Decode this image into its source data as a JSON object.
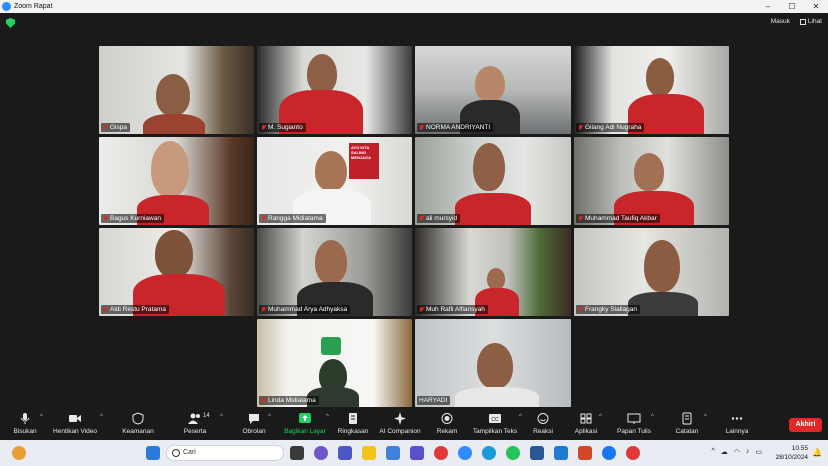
{
  "window": {
    "title": "Zoom Rapat",
    "minimize": "–",
    "maximize": "☐",
    "close": "✕"
  },
  "topbar": {
    "signin": "Masuk",
    "view": "Lihat"
  },
  "participants": [
    {
      "name": "Gispa"
    },
    {
      "name": "M. Sugianto"
    },
    {
      "name": "NORMA ANDRIYANTI"
    },
    {
      "name": "Gilang Adi Nugraha"
    },
    {
      "name": "Bagus Kurniawan"
    },
    {
      "name": "Rangga Midiatama"
    },
    {
      "name": "ali mursyid"
    },
    {
      "name": "Muhammad Taufiq Akbar"
    },
    {
      "name": "Aldi Restu Pratama"
    },
    {
      "name": "Muhammad Arya Adhyaksa"
    },
    {
      "name": "Muh Rafli Alfiansyah"
    },
    {
      "name": "Frangky Siallagan"
    },
    {
      "name": "Linda Midiatama"
    },
    {
      "name": "HARYADI"
    }
  ],
  "poster_text": "AYO KITA SALING MENJAGA",
  "toolbar": {
    "audio": "Bisukan",
    "video": "Hentikan Video",
    "security": "Keamanan",
    "participants": "Peserta",
    "participants_count": "14",
    "chat": "Obrolan",
    "share": "Bagikan Layar",
    "summary": "Ringkasan",
    "companion": "AI Companion",
    "record": "Rekam",
    "captions": "Tampilkan Teks",
    "reactions": "Reaksi",
    "apps": "Aplikasi",
    "whiteboard": "Papan Tulis",
    "notes": "Catatan",
    "more": "Lainnya",
    "end": "Akhiri"
  },
  "taskbar": {
    "search_placeholder": "Cari",
    "time": "10.55",
    "date": "28/10/2024"
  },
  "colors": {
    "accent_green": "#23d160",
    "end_red": "#e02828",
    "active_border": "#c6e86c"
  }
}
